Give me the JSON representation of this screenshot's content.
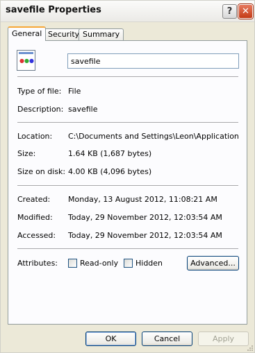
{
  "window": {
    "title": "savefile Properties"
  },
  "tabs": [
    "General",
    "Security",
    "Summary"
  ],
  "general": {
    "name_value": "savefile",
    "type_label": "Type of file:",
    "type_value": "File",
    "desc_label": "Description:",
    "desc_value": "savefile",
    "location_label": "Location:",
    "location_value": "C:\\Documents and Settings\\Leon\\Application Data\\",
    "size_label": "Size:",
    "size_value": "1.64 KB (1,687 bytes)",
    "sizeondisk_label": "Size on disk:",
    "sizeondisk_value": "4.00 KB (4,096 bytes)",
    "created_label": "Created:",
    "created_value": "Monday, 13 August 2012, 11:08:21 AM",
    "modified_label": "Modified:",
    "modified_value": "Today, 29 November 2012, 12:03:54 AM",
    "accessed_label": "Accessed:",
    "accessed_value": "Today, 29 November 2012, 12:03:54 AM",
    "attributes_label": "Attributes:",
    "readonly_label": "Read-only",
    "readonly_checked": false,
    "hidden_label": "Hidden",
    "hidden_checked": false,
    "advanced_label": "Advanced..."
  },
  "buttons": {
    "ok": "OK",
    "cancel": "Cancel",
    "apply": "Apply"
  },
  "icons": {
    "help": "?",
    "close": "✕"
  }
}
